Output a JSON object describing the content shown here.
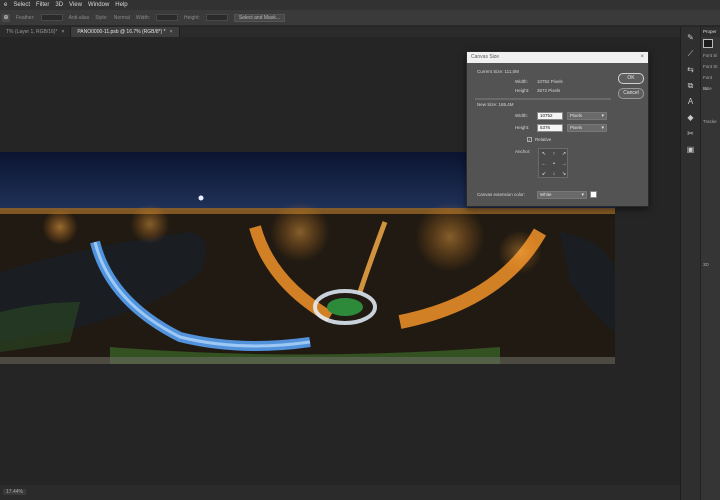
{
  "menubar": {
    "items": [
      "e",
      "Select",
      "Filter",
      "3D",
      "View",
      "Window",
      "Help"
    ]
  },
  "optionsbar": {
    "tool_glyph": "⊕",
    "labels": [
      "Feather:",
      "Anti-alias",
      "Style:",
      "Normal",
      "Width:",
      "Height:"
    ],
    "select_mask_button": "Select and Mask..."
  },
  "tabs": [
    {
      "label": "T% (Layer 1, RGB/16)*",
      "close": "×",
      "active": false
    },
    {
      "label": "PANO0000-11.psb @ 16.7% (RGB/8*) *",
      "close": "×",
      "active": true
    }
  ],
  "statusbar": {
    "zoom": "17.44%"
  },
  "righttools": {
    "icons": [
      "pen-tool-icon",
      "brush-icon",
      "adjust-icon",
      "clone-icon",
      "text-icon",
      "shape-icon",
      "scissors-icon",
      "frame-icon"
    ]
  },
  "rightpanel": {
    "title": "Proper",
    "rows": [
      "Font Si",
      "Font St",
      "",
      "Font Size",
      "Re",
      "",
      "",
      "Tracke",
      "",
      "",
      "3D",
      ""
    ]
  },
  "dialog": {
    "title": "Canvas Size",
    "close": "×",
    "current_size_label": "Current Size: 111,0M",
    "current_width_label": "Width:",
    "current_width_value": "10752 Pixels",
    "current_height_label": "Height:",
    "current_height_value": "3672 Pixels",
    "new_size_label": "New Size: 165,4M",
    "width_label": "Width:",
    "width_value": "10752",
    "width_unit": "Pixels",
    "height_label": "Height:",
    "height_value": "5376",
    "height_unit": "Pixels",
    "relative_label": "Relative",
    "relative_checked": "✓",
    "anchor_label": "Anchor:",
    "anchor_arrows": [
      "↖",
      "↑",
      "↗",
      "←",
      "•",
      "→",
      "↙",
      "↓",
      "↘"
    ],
    "extension_color_label": "Canvas extension color:",
    "extension_color_value": "White",
    "ok_label": "OK",
    "cancel_label": "Cancel"
  }
}
